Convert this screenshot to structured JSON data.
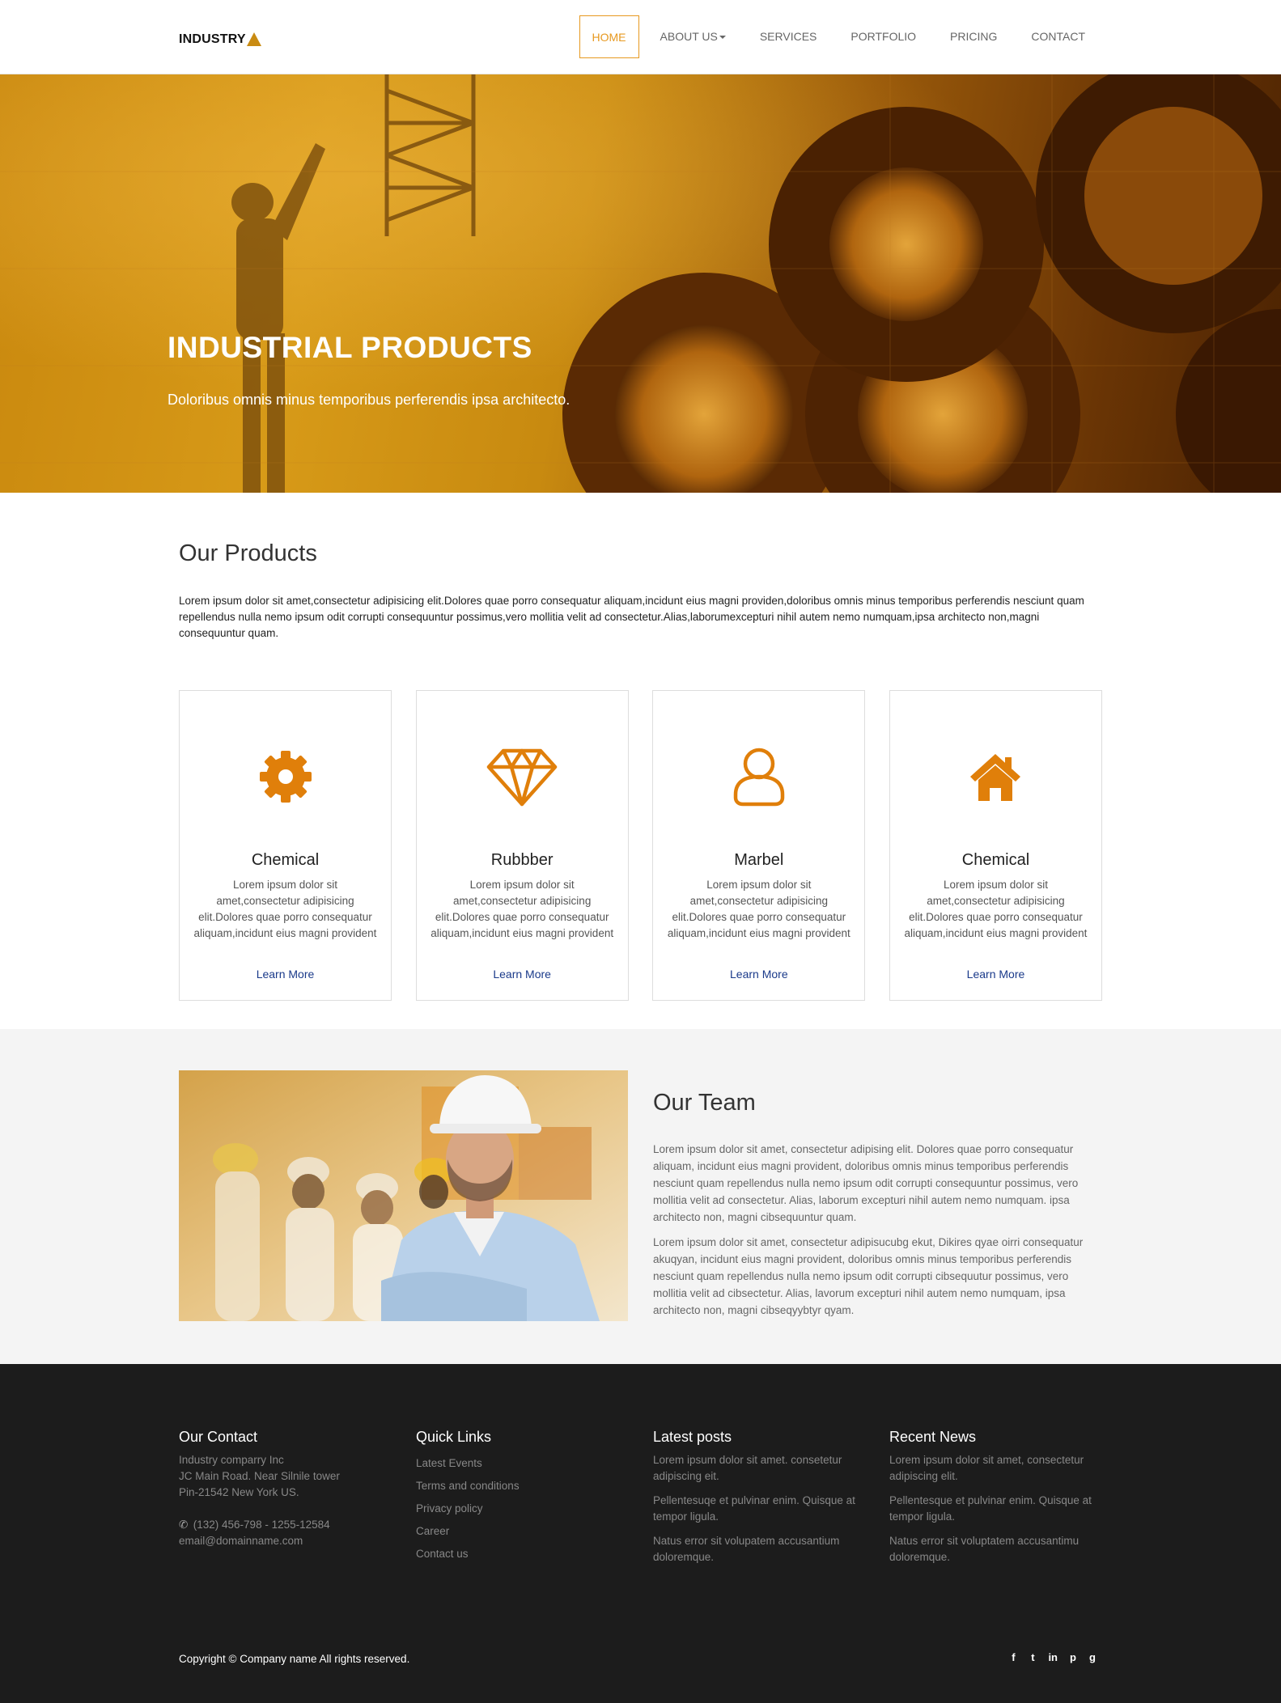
{
  "brand": {
    "name": "INDUSTRY"
  },
  "nav": {
    "items": [
      {
        "label": "HOME",
        "active": true
      },
      {
        "label": "ABOUT US",
        "dropdown": true
      },
      {
        "label": "SERVICES"
      },
      {
        "label": "PORTFOLIO"
      },
      {
        "label": "PRICING"
      },
      {
        "label": "CONTACT"
      }
    ]
  },
  "hero": {
    "title": "INDUSTRIAL PRODUCTS",
    "subtitle": "Doloribus omnis minus temporibus perferendis ipsa architecto."
  },
  "products": {
    "title": "Our Products",
    "intro": "Lorem ipsum dolor sit amet,consectetur adipisicing elit.Dolores quae porro consequatur aliquam,incidunt eius magni providen,doloribus omnis minus temporibus perferendis nesciunt quam repellendus nulla nemo ipsum odit corrupti consequuntur possimus,vero mollitia velit ad consectetur.Alias,laborumexcepturi nihil autem nemo numquam,ipsa architecto non,magni consequuntur quam.",
    "cards": [
      {
        "icon": "gear-icon",
        "title": "Chemical",
        "text": "Lorem ipsum dolor sit amet,consectetur adipisicing elit.Dolores quae porro consequatur aliquam,incidunt eius magni provident",
        "link": "Learn More"
      },
      {
        "icon": "diamond-icon",
        "title": "Rubbber",
        "text": "Lorem ipsum dolor sit amet,consectetur adipisicing elit.Dolores quae porro consequatur aliquam,incidunt eius magni provident",
        "link": "Learn More"
      },
      {
        "icon": "user-icon",
        "title": "Marbel",
        "text": "Lorem ipsum dolor sit amet,consectetur adipisicing elit.Dolores quae porro consequatur aliquam,incidunt eius magni provident",
        "link": "Learn More"
      },
      {
        "icon": "home-icon",
        "title": "Chemical",
        "text": "Lorem ipsum dolor sit amet,consectetur adipisicing elit.Dolores quae porro consequatur aliquam,incidunt eius magni provident",
        "link": "Learn More"
      }
    ]
  },
  "team": {
    "title": "Our Team",
    "p1": "Lorem ipsum dolor sit amet, consectetur adipising elit. Dolores quae porro consequatur aliquam, incidunt eius magni provident, doloribus omnis minus temporibus perferendis nesciunt quam repellendus nulla nemo ipsum odit corrupti consequuntur possimus, vero mollitia velit ad consectetur. Alias, laborum excepturi nihil autem nemo numquam. ipsa architecto non, magni cibsequuntur quam.",
    "p2": "Lorem ipsum dolor sit amet, consectetur adipisucubg ekut, Dikires qyae oirri consequatur akuqyan, incidunt eius magni provident, doloribus omnis minus temporibus perferendis nesciunt quam repellendus nulla nemo ipsum odit corrupti cibsequutur possimus, vero mollitia velit ad cibsectetur. Alias, lavorum excepturi nihil autem nemo numquam, ipsa architecto non, magni cibseqyybtyr qyam."
  },
  "footer": {
    "contact": {
      "title": "Our Contact",
      "company": "Industry comparry Inc",
      "address1": "JC Main Road. Near Silnile tower",
      "address2": "Pin-21542 New York US.",
      "phone": "(132) 456-798 - 1255-12584",
      "email": "email@domainname.com"
    },
    "quick_links": {
      "title": "Quick Links",
      "items": [
        "Latest Events",
        "Terms and conditions",
        "Privacy policy",
        "Career",
        "Contact us"
      ]
    },
    "latest_posts": {
      "title": "Latest posts",
      "items": [
        "Lorem ipsum dolor sit amet. consetetur adipiscing eit.",
        "Pellentesuqe et pulvinar enim. Quisque at tempor ligula.",
        "Natus error sit volupatem accusantium doloremque."
      ]
    },
    "recent_news": {
      "title": "Recent News",
      "items": [
        "Lorem ipsum dolor sit amet, consectetur adipiscing elit.",
        "Pellentesque et pulvinar enim. Quisque at tempor ligula.",
        "Natus error sit voluptatem accusantimu doloremque."
      ]
    },
    "copyright": "Copyright © Company name All rights reserved.",
    "social": [
      {
        "icon": "facebook-icon",
        "glyph": "f"
      },
      {
        "icon": "twitter-icon",
        "glyph": "t"
      },
      {
        "icon": "linkedin-icon",
        "glyph": "in"
      },
      {
        "icon": "pinterest-icon",
        "glyph": "p"
      },
      {
        "icon": "google-plus-icon",
        "glyph": "g"
      }
    ]
  },
  "colors": {
    "accent": "#e79920",
    "brand_triangle": "#c98b12",
    "footer_bg": "#1c1c1c",
    "team_bg": "#f4f4f4",
    "link": "#1a3a8a",
    "icon": "#e07f0a"
  }
}
